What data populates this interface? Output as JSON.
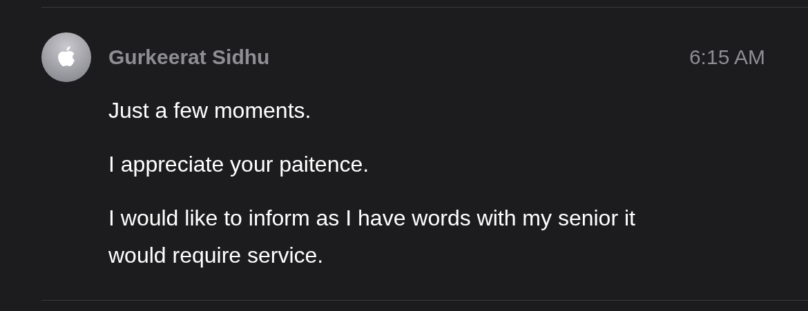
{
  "message": {
    "sender": "Gurkeerat Sidhu",
    "time": "6:15 AM",
    "lines": [
      "Just a few moments.",
      "I appreciate your paitence.",
      "I would like to inform as I have words with my senior it would require service."
    ]
  }
}
